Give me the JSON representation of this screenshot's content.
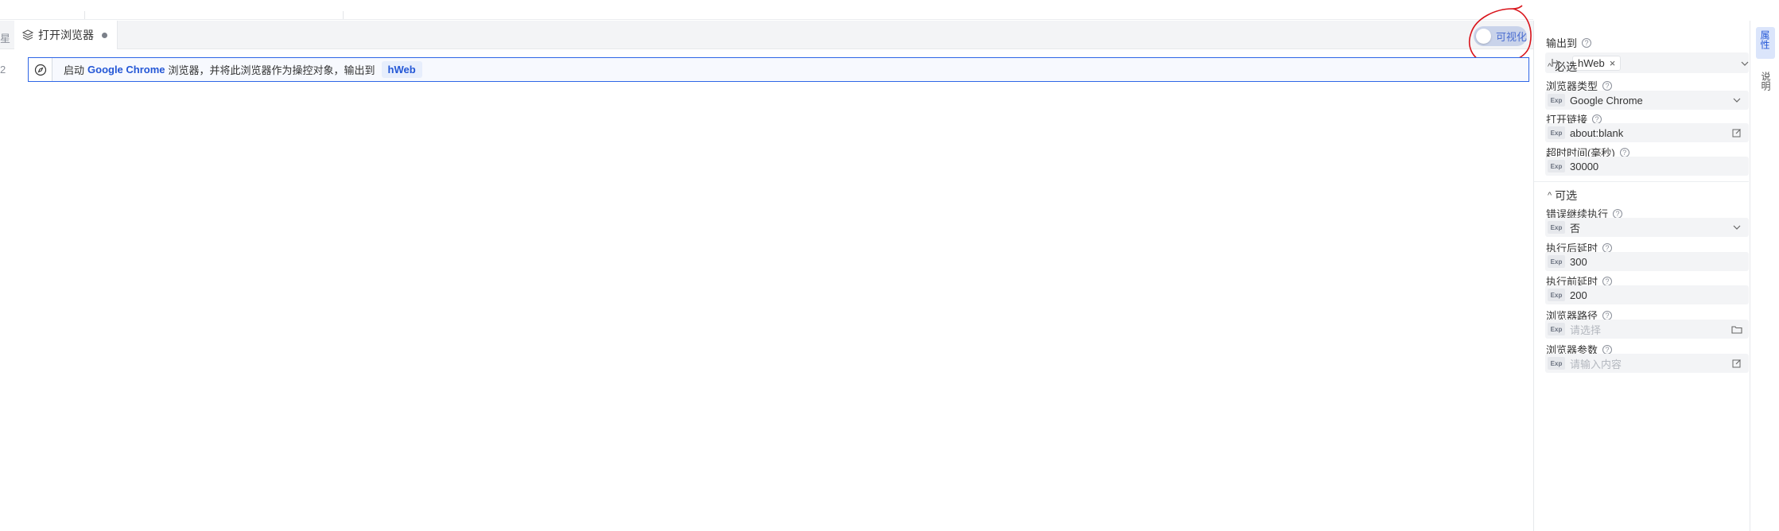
{
  "tabbar": {
    "prev_tab_fragment": "星",
    "active_tab": {
      "label": "打开浏览器",
      "icon": "layers-icon",
      "unsaved": true
    },
    "visualize_toggle": {
      "label": "可视化",
      "on": false
    }
  },
  "editor": {
    "line_number": "2",
    "command": {
      "icon": "compass-icon",
      "text_before": "启动",
      "browser": "Google Chrome",
      "text_after": "浏览器，并将此浏览器作为操控对象，输出到",
      "output_var": "hWeb"
    }
  },
  "panel": {
    "output": {
      "label": "输出到",
      "value": "hWeb"
    },
    "required_section": "必选",
    "browser_type": {
      "label": "浏览器类型",
      "exp": "Exp",
      "value": "Google Chrome"
    },
    "open_link": {
      "label": "打开链接",
      "exp": "Exp",
      "value": "about:blank"
    },
    "timeout": {
      "label": "超时时间(毫秒)",
      "exp": "Exp",
      "value": "30000"
    },
    "optional_section": "可选",
    "continue_on_error": {
      "label": "错误继续执行",
      "exp": "Exp",
      "value": "否"
    },
    "delay_after": {
      "label": "执行后延时",
      "exp": "Exp",
      "value": "300"
    },
    "delay_before": {
      "label": "执行前延时",
      "exp": "Exp",
      "value": "200"
    },
    "browser_path": {
      "label": "浏览器路径",
      "exp": "Exp",
      "placeholder": "请选择"
    },
    "browser_args": {
      "label": "浏览器参数",
      "exp": "Exp",
      "placeholder": "请输入内容"
    }
  },
  "side_tabs": {
    "properties": "属性",
    "help": "说明"
  },
  "colors": {
    "accent": "#2e66e6",
    "annotation": "#d9141b",
    "panel_bg": "#f3f4f6"
  }
}
